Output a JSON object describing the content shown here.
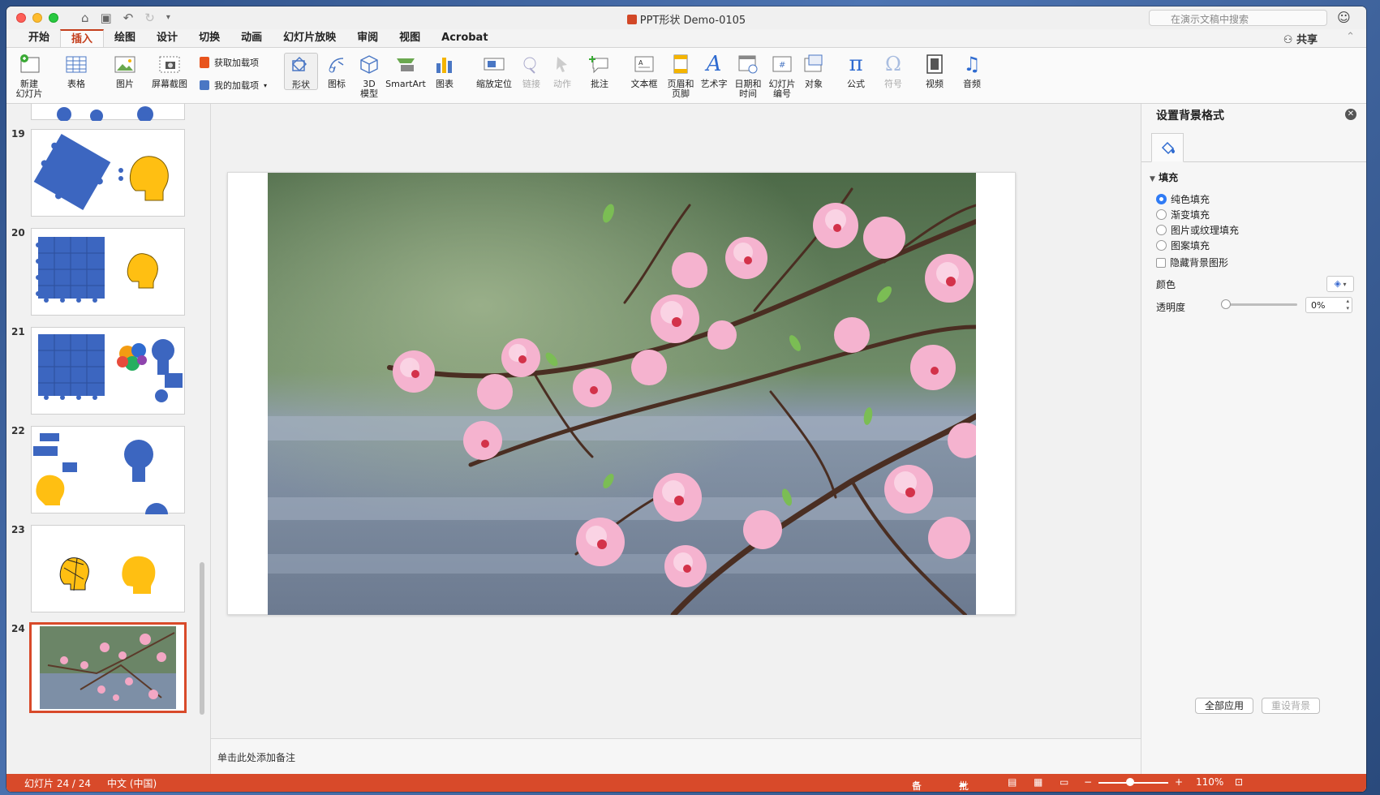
{
  "window": {
    "title": "PPT形状 Demo-0105",
    "search_placeholder": "在演示文稿中搜索"
  },
  "tabs": [
    "开始",
    "插入",
    "绘图",
    "设计",
    "切换",
    "动画",
    "幻灯片放映",
    "审阅",
    "视图",
    "Acrobat"
  ],
  "active_tab": "插入",
  "share_label": "共享",
  "ribbon": {
    "new_slide": "新建\n幻灯片",
    "table": "表格",
    "picture": "图片",
    "screenshot": "屏幕截图",
    "get_addins": "获取加载项",
    "my_addins": "我的加载项",
    "shapes": "形状",
    "icons": "图标",
    "model3d": "3D\n模型",
    "smartart": "SmartArt",
    "chart": "图表",
    "zoom": "缩放定位",
    "link": "链接",
    "action": "动作",
    "comment": "批注",
    "textbox": "文本框",
    "header_footer": "页眉和\n页脚",
    "wordart": "艺术字",
    "datetime": "日期和\n时间",
    "slide_number": "幻灯片\n编号",
    "object": "对象",
    "equation": "公式",
    "symbol": "符号",
    "video": "视频",
    "audio": "音频"
  },
  "slides": [
    {
      "num": "19"
    },
    {
      "num": "20"
    },
    {
      "num": "21"
    },
    {
      "num": "22"
    },
    {
      "num": "23"
    },
    {
      "num": "24"
    }
  ],
  "notes_placeholder": "单击此处添加备注",
  "format_pane": {
    "title": "设置背景格式",
    "section": "填充",
    "options": [
      "纯色填充",
      "渐变填充",
      "图片或纹理填充",
      "图案填充"
    ],
    "selected_option": "纯色填充",
    "hide_bg_label": "隐藏背景图形",
    "color_label": "颜色",
    "transparency_label": "透明度",
    "transparency_value": "0%",
    "apply_all": "全部应用",
    "reset_bg": "重设背景"
  },
  "status": {
    "slide_info": "幻灯片 24 / 24",
    "language": "中文 (中国)",
    "notes": "备注",
    "comments": "批注",
    "zoom": "110%",
    "zoom_level": 0.45
  },
  "colors": {
    "accent": "#d84a2a",
    "puzzle_blue": "#3c66c0",
    "head_yellow": "#ffbf12"
  }
}
